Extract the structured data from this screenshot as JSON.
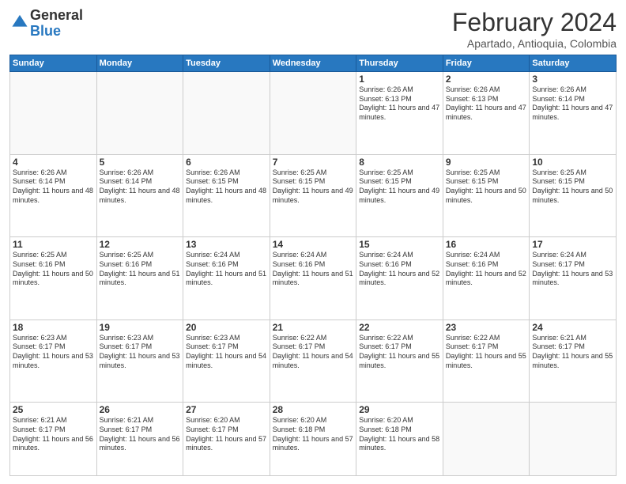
{
  "header": {
    "logo_general": "General",
    "logo_blue": "Blue",
    "title": "February 2024",
    "subtitle": "Apartado, Antioquia, Colombia"
  },
  "days_of_week": [
    "Sunday",
    "Monday",
    "Tuesday",
    "Wednesday",
    "Thursday",
    "Friday",
    "Saturday"
  ],
  "weeks": [
    [
      {
        "day": "",
        "info": ""
      },
      {
        "day": "",
        "info": ""
      },
      {
        "day": "",
        "info": ""
      },
      {
        "day": "",
        "info": ""
      },
      {
        "day": "1",
        "info": "Sunrise: 6:26 AM\nSunset: 6:13 PM\nDaylight: 11 hours and 47 minutes."
      },
      {
        "day": "2",
        "info": "Sunrise: 6:26 AM\nSunset: 6:13 PM\nDaylight: 11 hours and 47 minutes."
      },
      {
        "day": "3",
        "info": "Sunrise: 6:26 AM\nSunset: 6:14 PM\nDaylight: 11 hours and 47 minutes."
      }
    ],
    [
      {
        "day": "4",
        "info": "Sunrise: 6:26 AM\nSunset: 6:14 PM\nDaylight: 11 hours and 48 minutes."
      },
      {
        "day": "5",
        "info": "Sunrise: 6:26 AM\nSunset: 6:14 PM\nDaylight: 11 hours and 48 minutes."
      },
      {
        "day": "6",
        "info": "Sunrise: 6:26 AM\nSunset: 6:15 PM\nDaylight: 11 hours and 48 minutes."
      },
      {
        "day": "7",
        "info": "Sunrise: 6:25 AM\nSunset: 6:15 PM\nDaylight: 11 hours and 49 minutes."
      },
      {
        "day": "8",
        "info": "Sunrise: 6:25 AM\nSunset: 6:15 PM\nDaylight: 11 hours and 49 minutes."
      },
      {
        "day": "9",
        "info": "Sunrise: 6:25 AM\nSunset: 6:15 PM\nDaylight: 11 hours and 50 minutes."
      },
      {
        "day": "10",
        "info": "Sunrise: 6:25 AM\nSunset: 6:15 PM\nDaylight: 11 hours and 50 minutes."
      }
    ],
    [
      {
        "day": "11",
        "info": "Sunrise: 6:25 AM\nSunset: 6:16 PM\nDaylight: 11 hours and 50 minutes."
      },
      {
        "day": "12",
        "info": "Sunrise: 6:25 AM\nSunset: 6:16 PM\nDaylight: 11 hours and 51 minutes."
      },
      {
        "day": "13",
        "info": "Sunrise: 6:24 AM\nSunset: 6:16 PM\nDaylight: 11 hours and 51 minutes."
      },
      {
        "day": "14",
        "info": "Sunrise: 6:24 AM\nSunset: 6:16 PM\nDaylight: 11 hours and 51 minutes."
      },
      {
        "day": "15",
        "info": "Sunrise: 6:24 AM\nSunset: 6:16 PM\nDaylight: 11 hours and 52 minutes."
      },
      {
        "day": "16",
        "info": "Sunrise: 6:24 AM\nSunset: 6:16 PM\nDaylight: 11 hours and 52 minutes."
      },
      {
        "day": "17",
        "info": "Sunrise: 6:24 AM\nSunset: 6:17 PM\nDaylight: 11 hours and 53 minutes."
      }
    ],
    [
      {
        "day": "18",
        "info": "Sunrise: 6:23 AM\nSunset: 6:17 PM\nDaylight: 11 hours and 53 minutes."
      },
      {
        "day": "19",
        "info": "Sunrise: 6:23 AM\nSunset: 6:17 PM\nDaylight: 11 hours and 53 minutes."
      },
      {
        "day": "20",
        "info": "Sunrise: 6:23 AM\nSunset: 6:17 PM\nDaylight: 11 hours and 54 minutes."
      },
      {
        "day": "21",
        "info": "Sunrise: 6:22 AM\nSunset: 6:17 PM\nDaylight: 11 hours and 54 minutes."
      },
      {
        "day": "22",
        "info": "Sunrise: 6:22 AM\nSunset: 6:17 PM\nDaylight: 11 hours and 55 minutes."
      },
      {
        "day": "23",
        "info": "Sunrise: 6:22 AM\nSunset: 6:17 PM\nDaylight: 11 hours and 55 minutes."
      },
      {
        "day": "24",
        "info": "Sunrise: 6:21 AM\nSunset: 6:17 PM\nDaylight: 11 hours and 55 minutes."
      }
    ],
    [
      {
        "day": "25",
        "info": "Sunrise: 6:21 AM\nSunset: 6:17 PM\nDaylight: 11 hours and 56 minutes."
      },
      {
        "day": "26",
        "info": "Sunrise: 6:21 AM\nSunset: 6:17 PM\nDaylight: 11 hours and 56 minutes."
      },
      {
        "day": "27",
        "info": "Sunrise: 6:20 AM\nSunset: 6:17 PM\nDaylight: 11 hours and 57 minutes."
      },
      {
        "day": "28",
        "info": "Sunrise: 6:20 AM\nSunset: 6:18 PM\nDaylight: 11 hours and 57 minutes."
      },
      {
        "day": "29",
        "info": "Sunrise: 6:20 AM\nSunset: 6:18 PM\nDaylight: 11 hours and 58 minutes."
      },
      {
        "day": "",
        "info": ""
      },
      {
        "day": "",
        "info": ""
      }
    ]
  ]
}
